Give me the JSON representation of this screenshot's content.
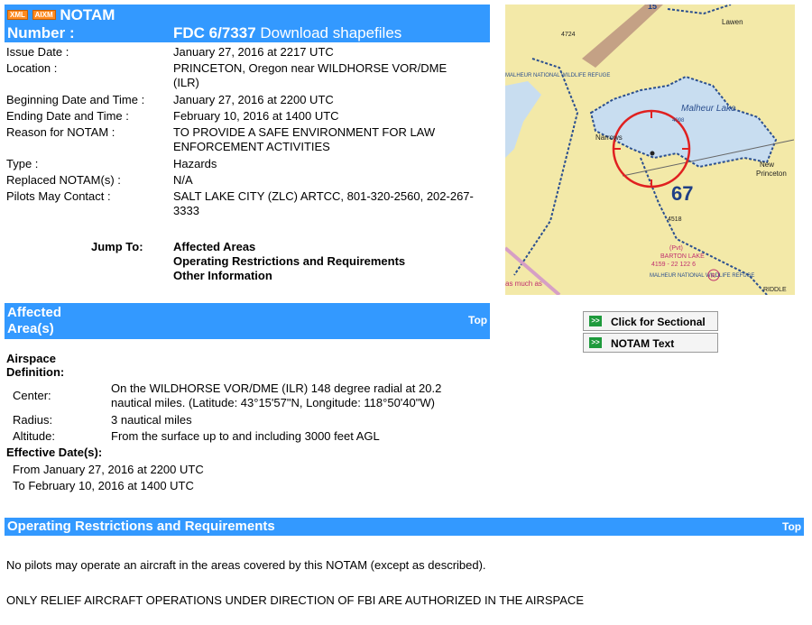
{
  "header": {
    "badge_xml": "XML",
    "badge_aixm": "AIXM",
    "title": "NOTAM",
    "number_label": "Number :",
    "number_value": "FDC 6/7337",
    "download_link": "Download shapefiles"
  },
  "fields": [
    {
      "label": "Issue Date :",
      "value": "January 27, 2016 at 2217 UTC"
    },
    {
      "label": "Location :",
      "value": "PRINCETON, Oregon near WILDHORSE VOR/DME (ILR)"
    },
    {
      "label": "Beginning Date and Time :",
      "value": "January 27, 2016 at 2200 UTC"
    },
    {
      "label": "Ending Date and Time :",
      "value": "February 10, 2016 at 1400 UTC"
    },
    {
      "label": "Reason for NOTAM :",
      "value": "TO PROVIDE A SAFE ENVIRONMENT FOR LAW ENFORCEMENT ACTIVITIES"
    },
    {
      "label": "Type :",
      "value": "Hazards"
    },
    {
      "label": "Replaced NOTAM(s) :",
      "value": "N/A"
    },
    {
      "label": "Pilots May Contact :",
      "value": "SALT LAKE CITY (ZLC) ARTCC, 801-320-2560, 202-267-3333"
    }
  ],
  "jump": {
    "label": "Jump To:",
    "links": [
      "Affected Areas",
      "Operating Restrictions and Requirements",
      "Other Information"
    ]
  },
  "map": {
    "labels": {
      "malheur_lake": "Malheur Lake",
      "refuge": "MALHEUR NATIONAL WILDLIFE REFUGE",
      "narrows": "Narrows",
      "princeton": "Princeton",
      "new": "New",
      "lawen": "Lawen",
      "sixty_seven": "67",
      "elev_4724": "4724",
      "elev_4518": "4518",
      "elev_4098": "4098",
      "barton": "BARTON LAKE",
      "pvt": "(Pvt)",
      "barton_info": "4159 - 22 122 6",
      "riddle": "RIDDLE",
      "as_much_as": "as much as",
      "refuge2": "MALHEUR NATIONAL WILDLIFE REFUGE",
      "r": "R",
      "top_num": "15"
    },
    "colors": {
      "land": "#f3e9a8",
      "water": "#c8ddf0",
      "boundary": "#2b4f8f",
      "circle": "#e02020"
    }
  },
  "side_buttons": {
    "sectional": "Click for Sectional",
    "notam_text": "NOTAM Text",
    "go": ">>"
  },
  "affected": {
    "title_line1": "Affected",
    "title_line2": "Area(s)",
    "top": "Top",
    "airspace_label_1": "Airspace",
    "airspace_label_2": "Definition:",
    "rows": [
      {
        "label": "Center:",
        "value": "On the WILDHORSE VOR/DME (ILR) 148 degree radial at 20.2 nautical miles. (Latitude: 43°15'57\"N, Longitude: 118°50'40\"W)"
      },
      {
        "label": "Radius:",
        "value": "3 nautical miles"
      },
      {
        "label": "Altitude:",
        "value": "From the surface up to and including 3000 feet AGL"
      }
    ],
    "effective_label": "Effective Date(s):",
    "from": "From January 27, 2016 at 2200 UTC",
    "to": "To February 10, 2016 at 1400 UTC"
  },
  "operating": {
    "title": "Operating Restrictions and Requirements",
    "top": "Top",
    "para1": "No pilots may operate an aircraft in the areas covered by this NOTAM (except as described).",
    "para2": "ONLY RELIEF AIRCRAFT OPERATIONS UNDER DIRECTION OF FBI ARE AUTHORIZED IN THE AIRSPACE"
  }
}
